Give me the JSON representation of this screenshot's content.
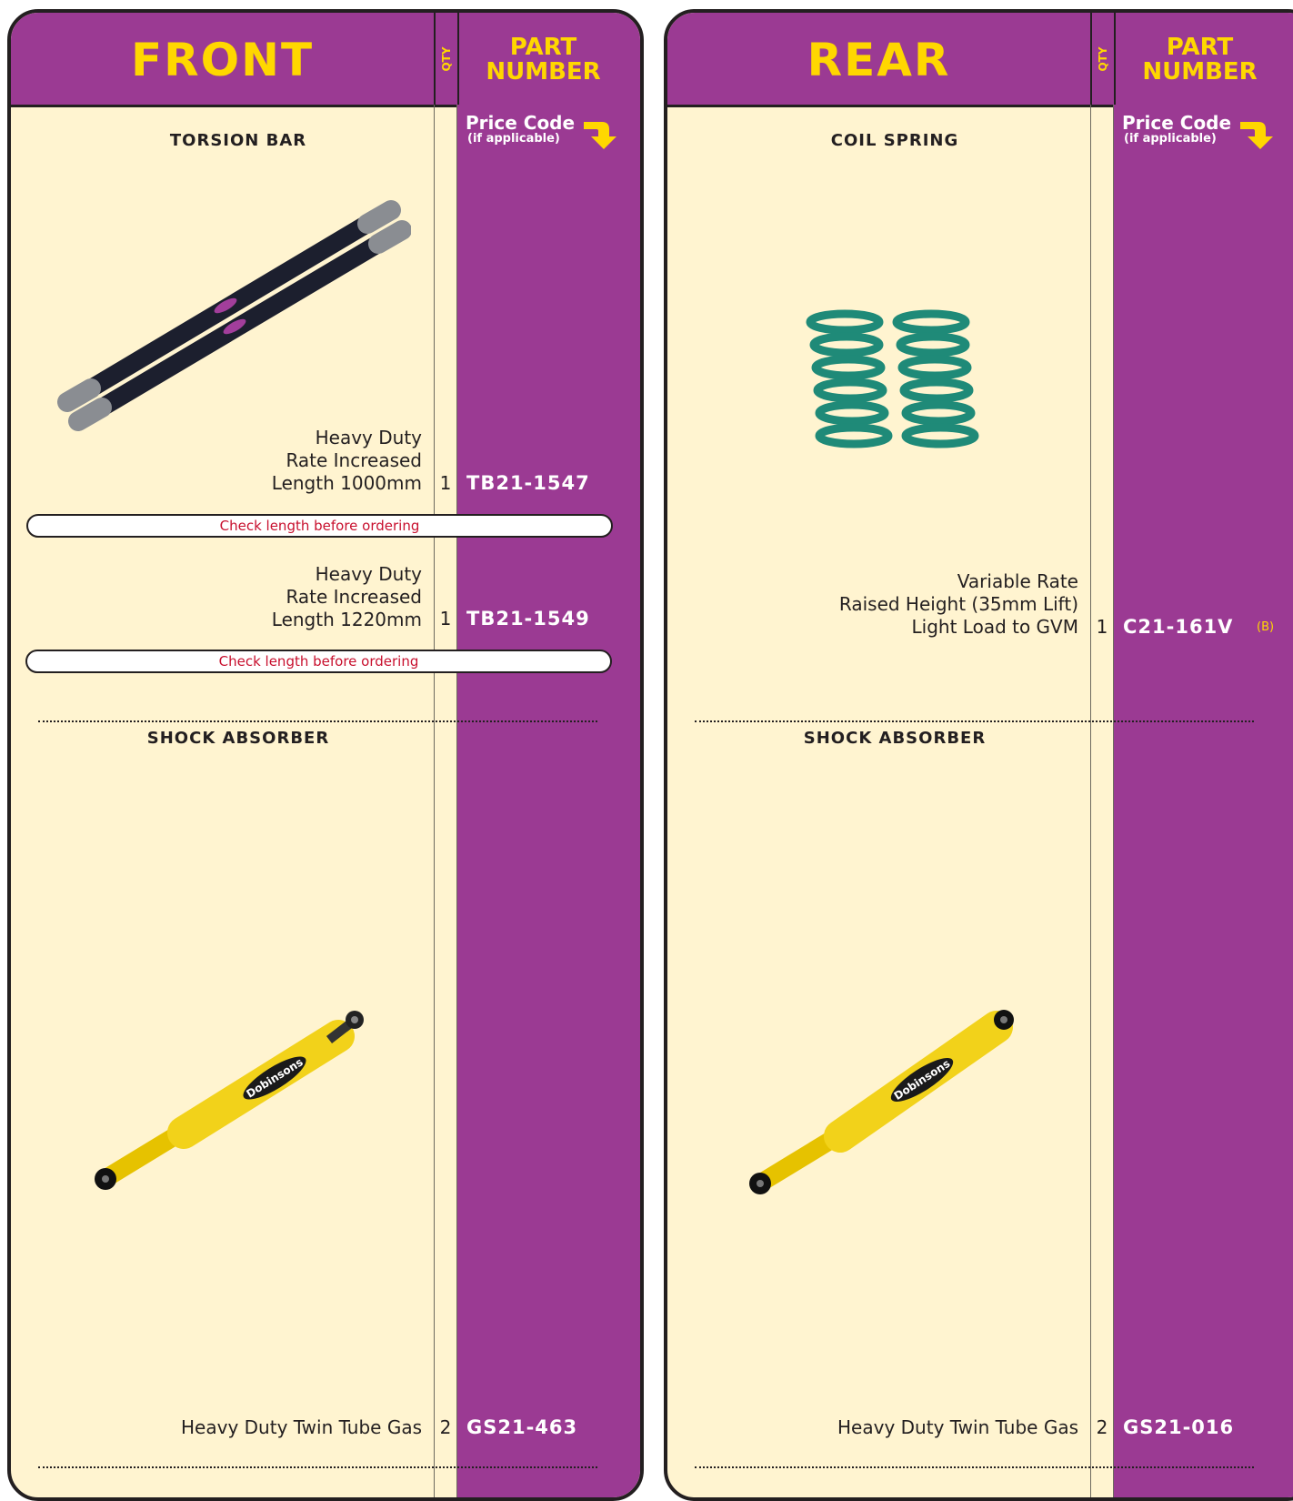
{
  "front": {
    "title": "FRONT",
    "qty_header": "QTY",
    "part_header_1": "PART",
    "part_header_2": "NUMBER",
    "price_code": "Price Code",
    "price_sub": "(if applicable)",
    "torsion": {
      "title": "TORSION BAR",
      "items": [
        {
          "lines": [
            "Heavy Duty",
            "Rate Increased",
            "Length 1000mm"
          ],
          "qty": "1",
          "part": "TB21-1547",
          "note": "Check length before ordering"
        },
        {
          "lines": [
            "Heavy Duty",
            "Rate Increased",
            "Length 1220mm"
          ],
          "qty": "1",
          "part": "TB21-1549",
          "note": "Check length before ordering"
        }
      ]
    },
    "shock": {
      "title": "SHOCK ABSORBER",
      "desc": "Heavy Duty Twin Tube Gas",
      "qty": "2",
      "part": "GS21-463",
      "brand": "Dobinsons"
    }
  },
  "rear": {
    "title": "REAR",
    "qty_header": "QTY",
    "part_header_1": "PART",
    "part_header_2": "NUMBER",
    "price_code": "Price Code",
    "price_sub": "(if applicable)",
    "coil": {
      "title": "COIL SPRING",
      "lines": [
        "Variable Rate",
        "Raised Height (35mm Lift)",
        "Light Load to GVM"
      ],
      "qty": "1",
      "part": "C21-161V",
      "price": "(B)"
    },
    "shock": {
      "title": "SHOCK ABSORBER",
      "desc": "Heavy Duty Twin Tube Gas",
      "qty": "2",
      "part": "GS21-016",
      "brand": "Dobinsons"
    }
  },
  "colors": {
    "purple": "#9b3a93",
    "yellow": "#ffd700",
    "cream": "#fff4d0",
    "red_note": "#c8102e",
    "spring_green": "#1f8a78"
  }
}
